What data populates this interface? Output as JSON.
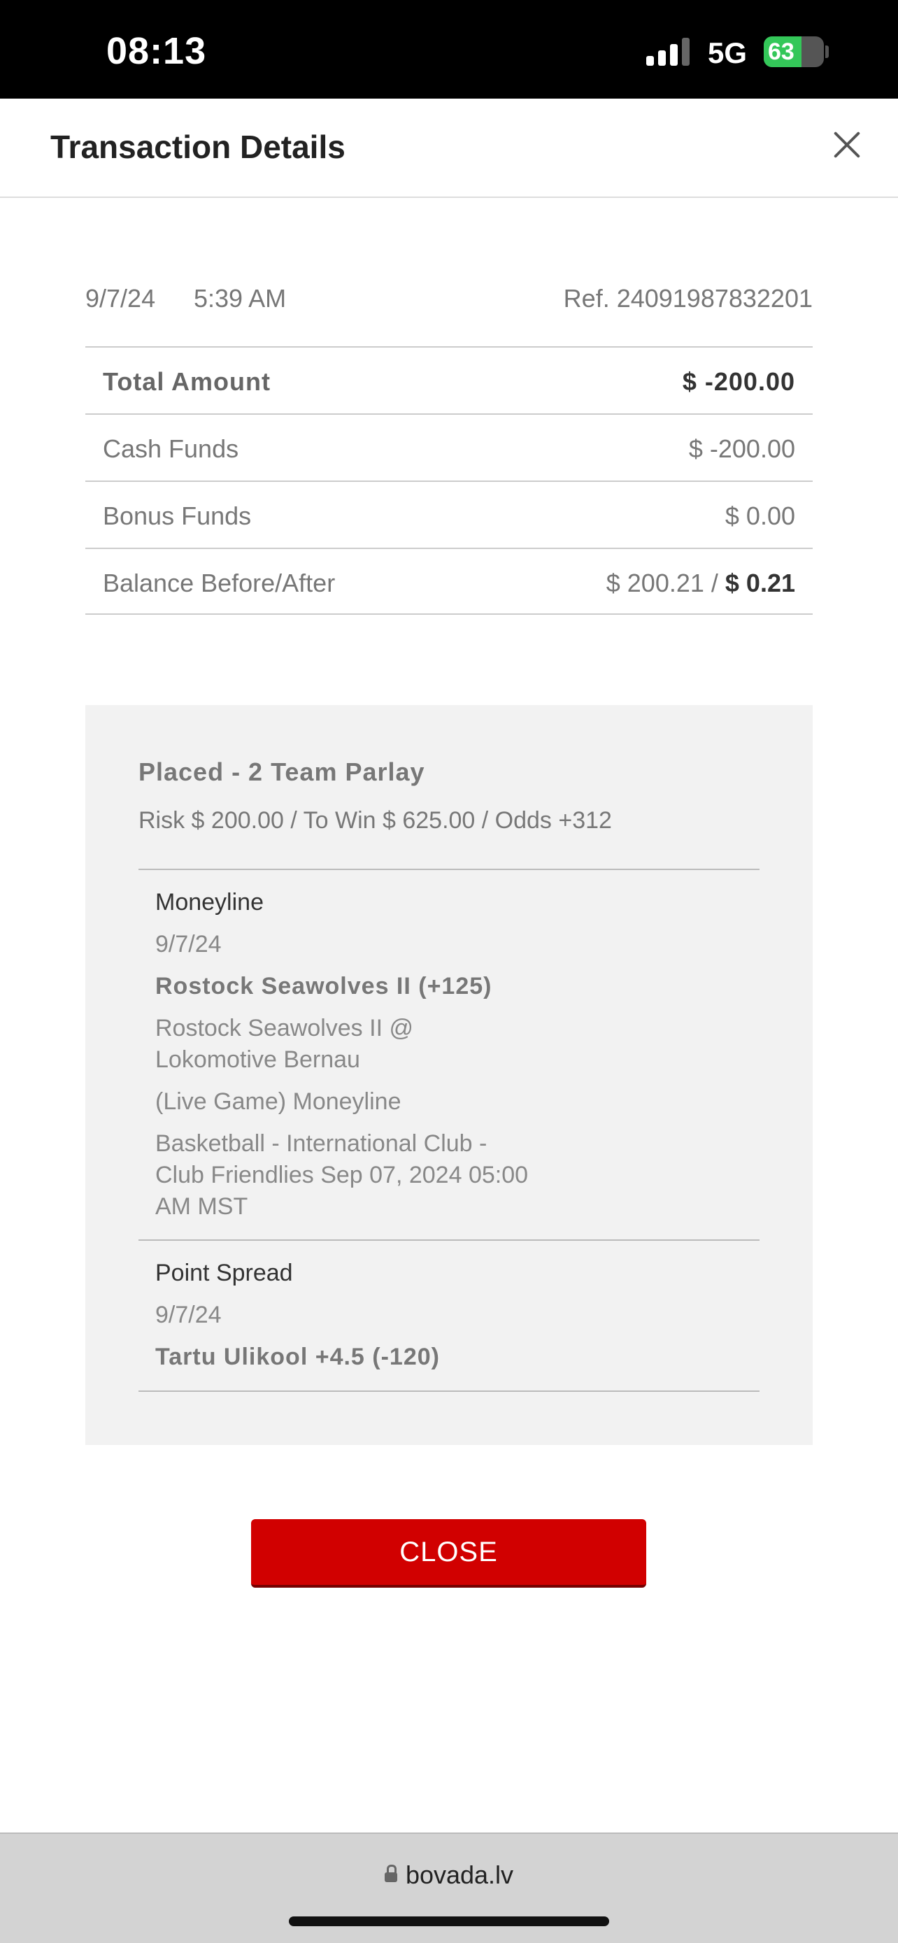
{
  "status_bar": {
    "time": "08:13",
    "network": "5G",
    "battery_percent": "63",
    "battery_level": 0.63,
    "signal_bars": 3,
    "colors": {
      "background": "#000000",
      "battery": "#34c759"
    }
  },
  "header": {
    "title": "Transaction Details",
    "close_icon": "close-icon"
  },
  "transaction": {
    "date": "9/7/24",
    "time": "5:39 AM",
    "ref": "Ref. 24091987832201",
    "rows": [
      {
        "label": "Total Amount",
        "value": "$ -200.00"
      },
      {
        "label": "Cash Funds",
        "value": "$ -200.00"
      },
      {
        "label": "Bonus Funds",
        "value": "$ 0.00"
      },
      {
        "label": "Balance Before/After",
        "value_before": "$ 200.21 /",
        "value_after": "$ 0.21"
      }
    ]
  },
  "bet": {
    "title": "Placed - 2 Team Parlay",
    "summary": "Risk $ 200.00 / To Win $ 625.00 / Odds +312",
    "legs": [
      {
        "type": "Moneyline",
        "date": "9/7/24",
        "pick": "Rostock Seawolves II (+125)",
        "matchup_line1": "Rostock Seawolves II @",
        "matchup_line2": "Lokomotive Bernau",
        "market": "(Live Game) Moneyline",
        "event_line1": "Basketball - International Club -",
        "event_line2": "Club Friendlies Sep 07, 2024 05:00",
        "event_line3": "AM MST"
      },
      {
        "type": "Point Spread",
        "date": "9/7/24",
        "pick": "Tartu Ulikool +4.5 (-120)"
      }
    ]
  },
  "actions": {
    "close_label": "CLOSE",
    "close_color": "#d10000"
  },
  "browser": {
    "url": "bovada.lv",
    "lock_icon": "lock-icon"
  }
}
